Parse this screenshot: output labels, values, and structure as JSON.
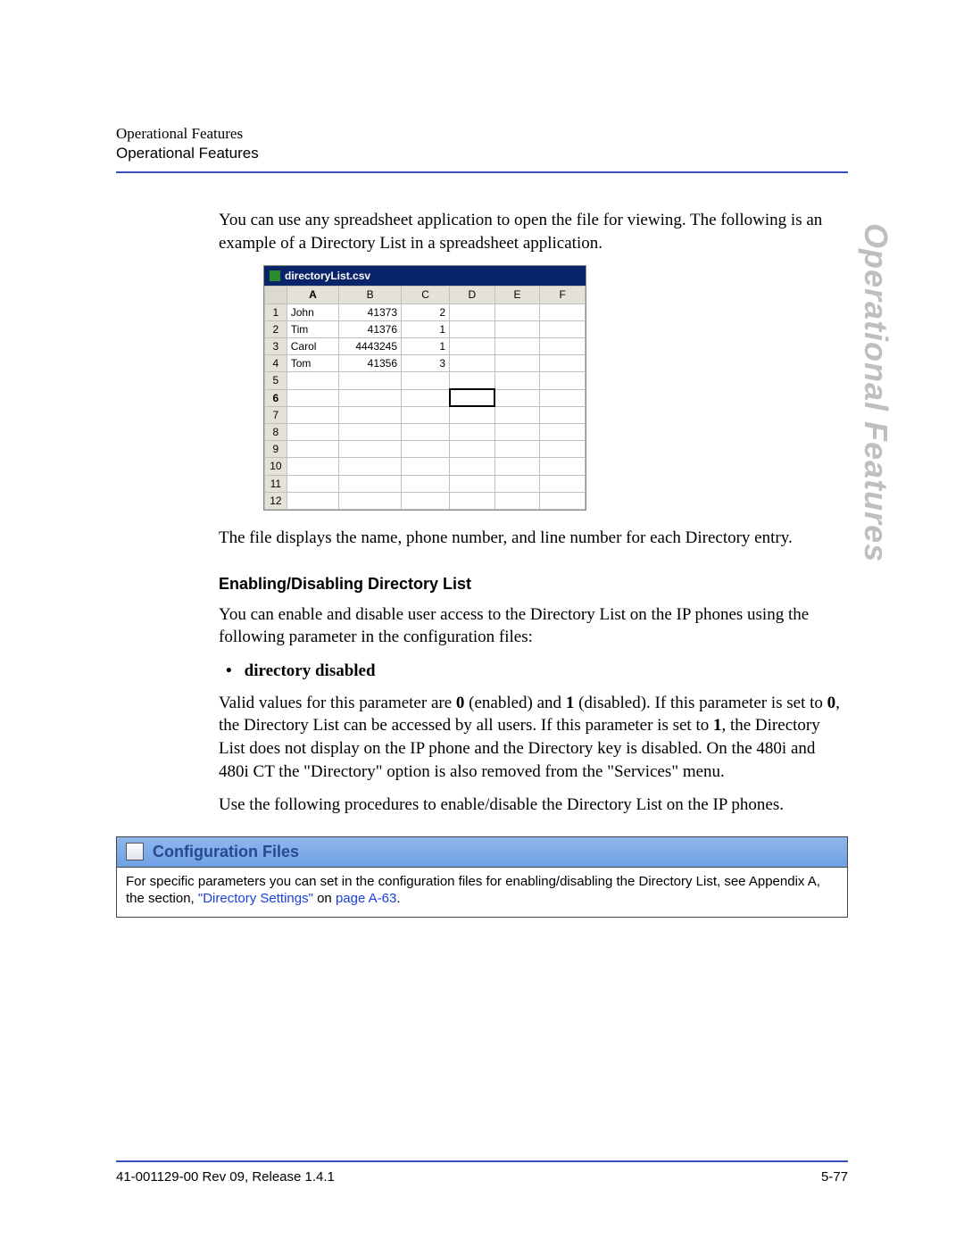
{
  "header": {
    "line1": "Operational Features",
    "line2": "Operational Features"
  },
  "side_tab": "Operational Features",
  "body": {
    "intro1": "You can use any spreadsheet application to open the file for viewing. The following is an example of a Directory List in a spreadsheet application.",
    "intro2": "The file displays the name, phone number, and line number for each Directory entry.",
    "h2_enable": "Enabling/Disabling Directory List",
    "enable_para": "You can enable and disable user access to the Directory List on the IP phones using the following parameter in the configuration files:",
    "bullet1": "directory disabled",
    "valid_para": "Valid values for this parameter are 0 (enabled) and 1 (disabled). If this parameter is set to 0, the Directory List can be accessed by all users.  If this parameter is set to 1, the Directory List does not display on the IP phone and the Directory key is disabled. On the 480i and 480i CT the \"Directory\" option is also removed from the \"Services\" menu.",
    "use_para": "Use the following procedures to enable/disable the Directory List on the IP phones."
  },
  "spreadsheet": {
    "title": "directoryList.csv",
    "columns": [
      "A",
      "B",
      "C",
      "D",
      "E",
      "F"
    ],
    "active_cell": "D6",
    "rows": [
      {
        "n": "1",
        "A": "John",
        "B": "41373",
        "C": "2"
      },
      {
        "n": "2",
        "A": "Tim",
        "B": "41376",
        "C": "1"
      },
      {
        "n": "3",
        "A": "Carol",
        "B": "4443245",
        "C": "1"
      },
      {
        "n": "4",
        "A": "Tom",
        "B": "41356",
        "C": "3"
      },
      {
        "n": "5"
      },
      {
        "n": "6"
      },
      {
        "n": "7"
      },
      {
        "n": "8"
      },
      {
        "n": "9"
      },
      {
        "n": "10"
      },
      {
        "n": "11"
      },
      {
        "n": "12"
      }
    ]
  },
  "config_box": {
    "title": "Configuration Files",
    "body_pre": "For specific parameters you can set in the configuration files for enabling/disabling the Directory List, see Appendix A, the section, ",
    "link_text": "\"Directory Settings\"",
    "body_mid": " on ",
    "page_ref": "page A-63",
    "body_post": "."
  },
  "footer": {
    "left": "41-001129-00 Rev 09, Release 1.4.1",
    "right": "5-77"
  }
}
